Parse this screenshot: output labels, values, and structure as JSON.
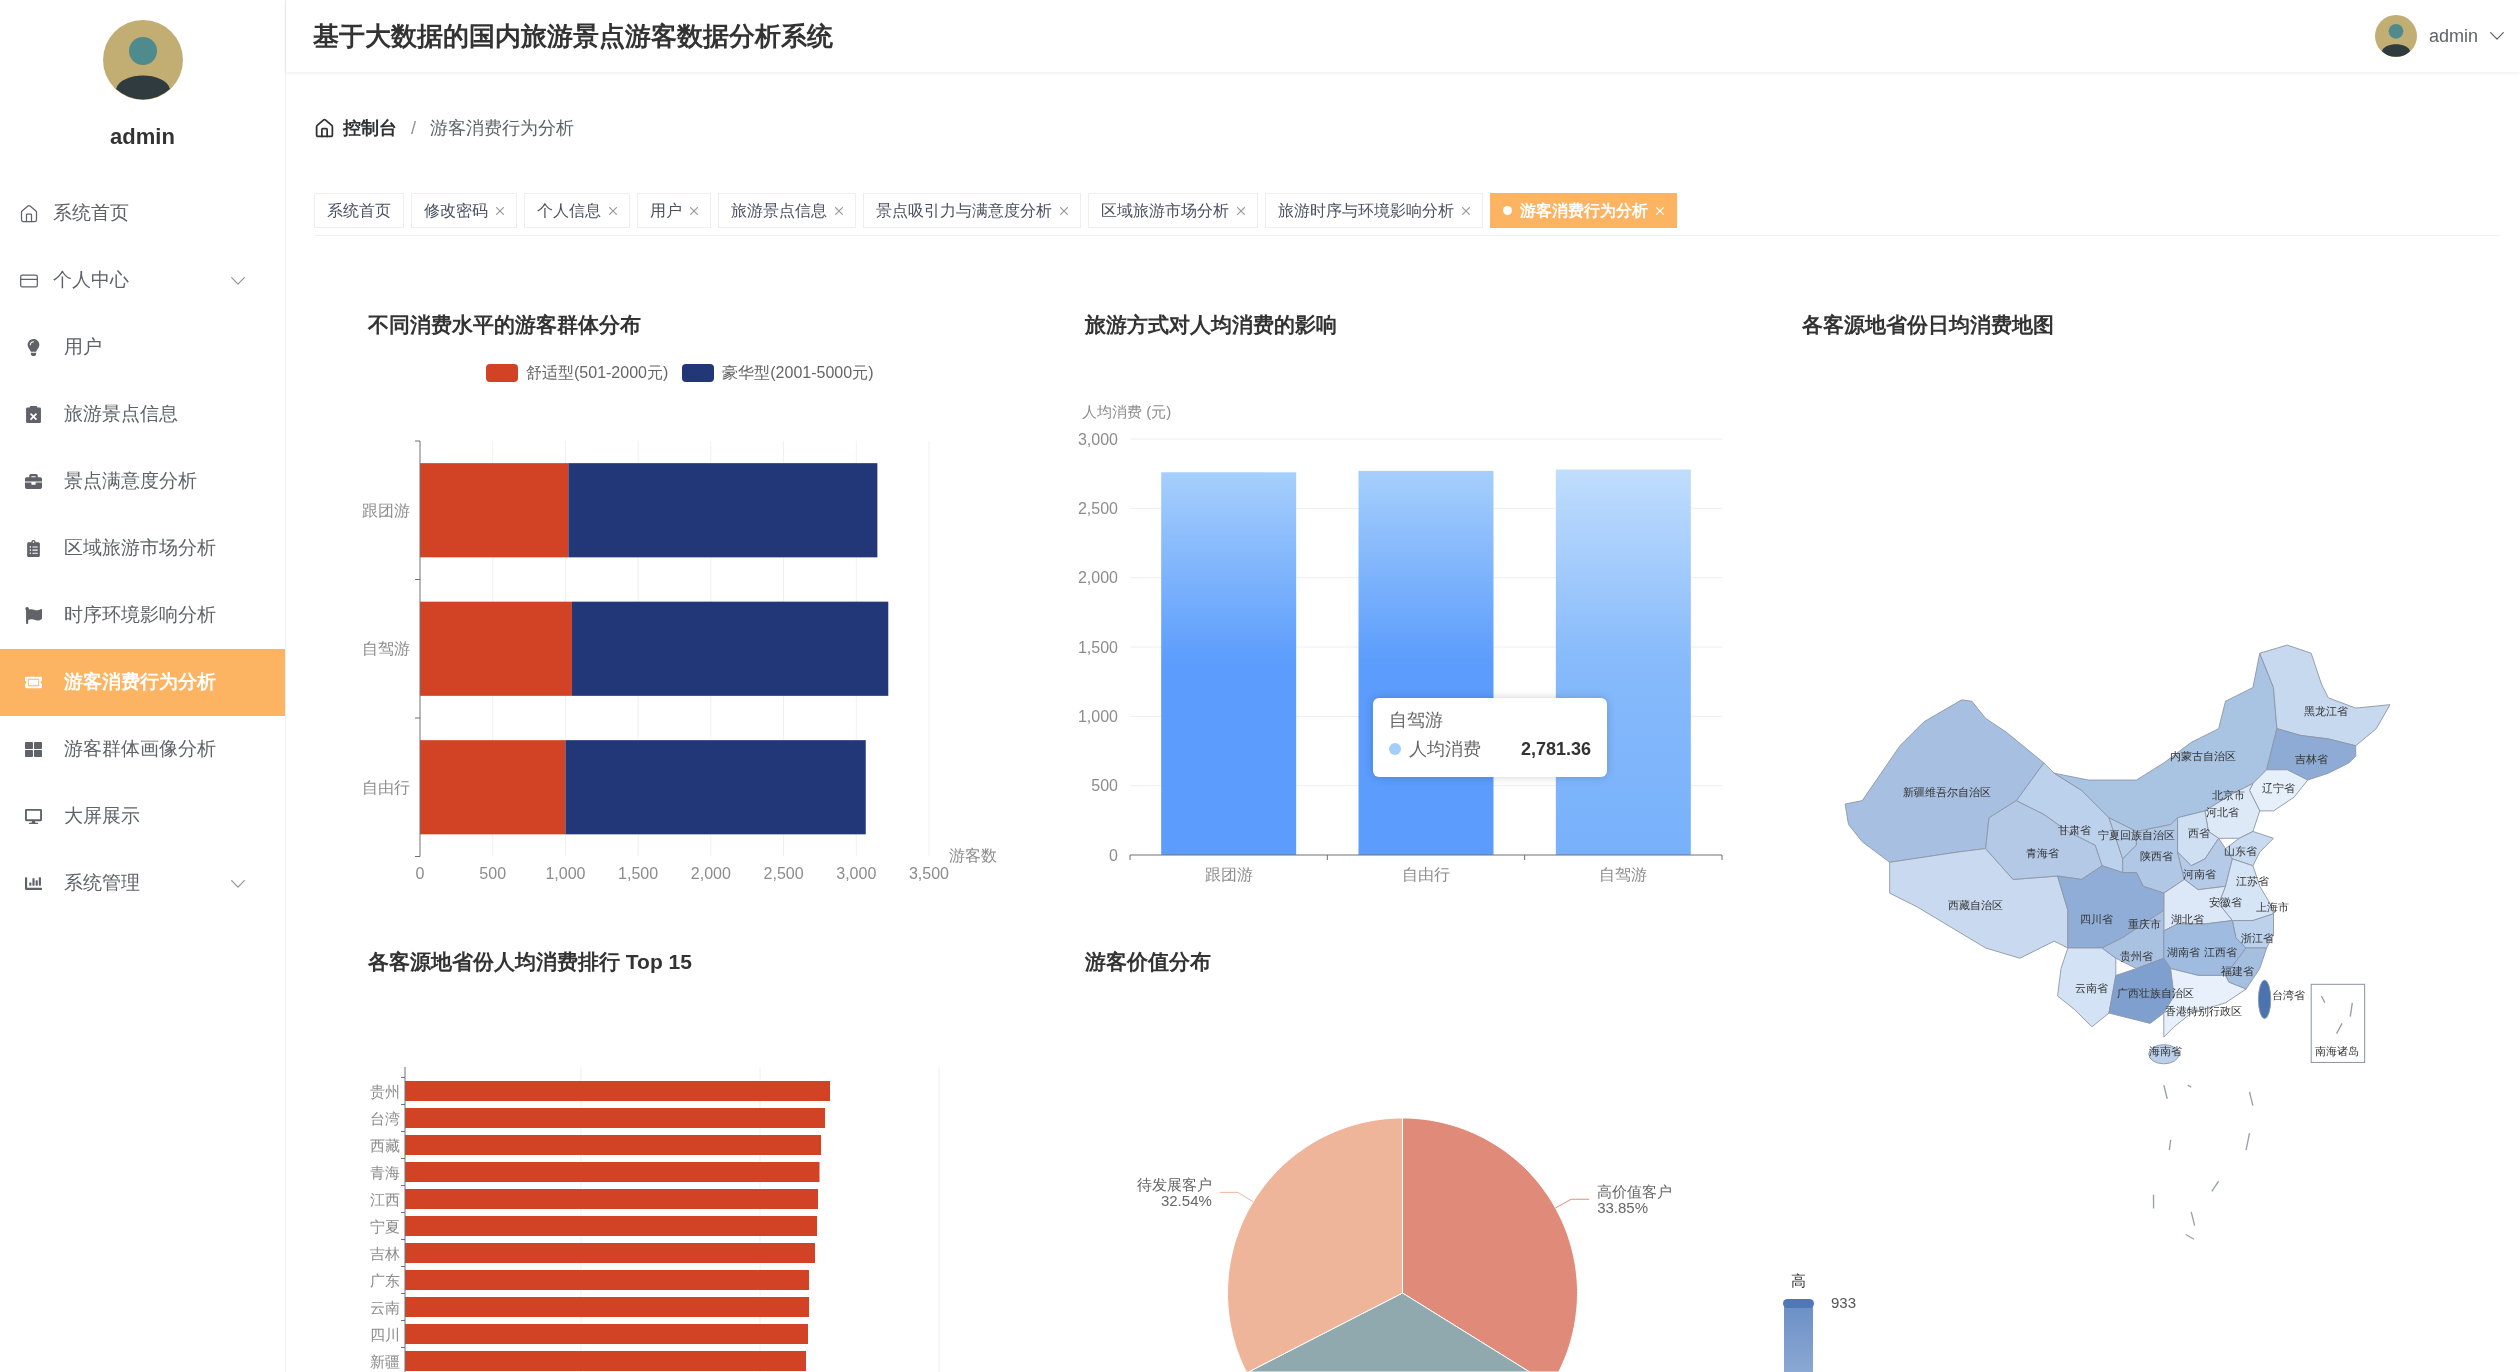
{
  "sidebar": {
    "user": {
      "name": "admin"
    },
    "menu": [
      {
        "label": "系统首页",
        "submenu": false,
        "selected": false
      },
      {
        "label": "个人中心",
        "submenu": true,
        "selected": false
      },
      {
        "label": "用户",
        "submenu": false,
        "selected": false
      },
      {
        "label": "旅游景点信息",
        "submenu": false,
        "selected": false
      },
      {
        "label": "景点满意度分析",
        "submenu": false,
        "selected": false
      },
      {
        "label": "区域旅游市场分析",
        "submenu": false,
        "selected": false
      },
      {
        "label": "时序环境影响分析",
        "submenu": false,
        "selected": false
      },
      {
        "label": "游客消费行为分析",
        "submenu": false,
        "selected": true
      },
      {
        "label": "游客群体画像分析",
        "submenu": false,
        "selected": false
      },
      {
        "label": "大屏展示",
        "submenu": false,
        "selected": false
      },
      {
        "label": "系统管理",
        "submenu": true,
        "selected": false
      }
    ]
  },
  "header": {
    "title": "基于大数据的国内旅游景点游客数据分析系统",
    "user": {
      "name": "admin"
    }
  },
  "breadcrumb": {
    "separator": "/",
    "items": [
      {
        "label": "控制台",
        "kind": "home"
      },
      {
        "label": "游客消费行为分析",
        "kind": "page"
      }
    ]
  },
  "tabs": [
    {
      "label": "系统首页",
      "closable": false,
      "selected": false
    },
    {
      "label": "修改密码",
      "closable": true,
      "selected": false
    },
    {
      "label": "个人信息",
      "closable": true,
      "selected": false
    },
    {
      "label": "用户",
      "closable": true,
      "selected": false
    },
    {
      "label": "旅游景点信息",
      "closable": true,
      "selected": false
    },
    {
      "label": "景点吸引力与满意度分析",
      "closable": true,
      "selected": false
    },
    {
      "label": "区域旅游市场分析",
      "closable": true,
      "selected": false
    },
    {
      "label": "旅游时序与环境影响分析",
      "closable": true,
      "selected": false
    },
    {
      "label": "游客消费行为分析",
      "closable": true,
      "selected": true
    }
  ],
  "dashboard": {
    "consumption_levels": {
      "chart_data": {
        "type": "bar",
        "title": "不同消费水平的游客群体分布",
        "orientation": "horizontal",
        "stacked": true,
        "grid": true,
        "legend": true,
        "xlabel": "游客数",
        "categories": [
          "跟团游",
          "自驾游",
          "自由行"
        ],
        "series": [
          {
            "name": "舒适型(501-2000元)",
            "color": "#d24325",
            "values": [
              1020,
              1045,
              1000
            ]
          },
          {
            "name": "豪华型(2001-5000元)",
            "color": "#223777",
            "values": [
              2125,
              2175,
              2065
            ]
          }
        ],
        "xlim": [
          0,
          3500
        ],
        "xticks": [
          {
            "value": 0,
            "label": "0"
          },
          {
            "value": 500,
            "label": "500"
          },
          {
            "value": 1000,
            "label": "1,000"
          },
          {
            "value": 1500,
            "label": "1,500"
          },
          {
            "value": 2000,
            "label": "2,000"
          },
          {
            "value": 2500,
            "label": "2,500"
          },
          {
            "value": 3000,
            "label": "3,000"
          },
          {
            "value": 3500,
            "label": "3,500"
          }
        ]
      }
    },
    "travel_mode_spending": {
      "chart_data": {
        "type": "bar",
        "title": "旅游方式对人均消费的影响",
        "orientation": "vertical",
        "grid": true,
        "ylabel": "人均消费 (元)",
        "categories": [
          "跟团游",
          "自由行",
          "自驾游"
        ],
        "series": [
          {
            "name": "人均消费",
            "color": "#5b9cfc",
            "values": [
              2760,
              2770,
              2780
            ]
          }
        ],
        "ylim": [
          0,
          3000
        ],
        "yticks": [
          {
            "value": 0,
            "label": "0"
          },
          {
            "value": 500,
            "label": "500"
          },
          {
            "value": 1000,
            "label": "1,000"
          },
          {
            "value": 1500,
            "label": "1,500"
          },
          {
            "value": 2000,
            "label": "2,000"
          },
          {
            "value": 2500,
            "label": "2,500"
          },
          {
            "value": 3000,
            "label": "3,000"
          }
        ]
      },
      "highlighted": [
        false,
        false,
        true
      ],
      "tooltip": {
        "title": "自驾游",
        "value": "2,781.36"
      }
    },
    "province_map": {
      "title": "各客源地省份日均消费地图",
      "labels": [
        "黑龙江省",
        "内蒙古自治区",
        "吉林省",
        "新疆维吾尔自治区",
        "北京市",
        "辽宁省",
        "河北省",
        "甘肃省",
        "宁夏回族自治区",
        "西省",
        "青海省",
        "陕西省",
        "山东省",
        "河南省",
        "江苏省",
        "西藏自治区",
        "安徽省",
        "上海市",
        "四川省",
        "重庆市",
        "湖北省",
        "浙江省",
        "贵州省",
        "湖南省",
        "江西省",
        "福建省",
        "云南省",
        "广西壮族自治区",
        "台湾省",
        "香港特别行政区",
        "海南省"
      ],
      "inset_label": "南海诸岛",
      "visual_map": {
        "high_label": "高",
        "value": "933"
      }
    },
    "province_ranking": {
      "title": "各客源地省份人均消费排行 Top 15",
      "labels": [
        "贵州",
        "台湾",
        "西藏",
        "青海",
        "江西",
        "宁夏",
        "吉林",
        "广东",
        "云南",
        "四川",
        "新疆"
      ]
    },
    "customer_value": {
      "chart_data": {
        "type": "pie",
        "title": "游客价值分布",
        "categories": [
          "高价值客户",
          null,
          "待发展客户"
        ],
        "values": [
          33.85,
          33.61,
          32.54
        ],
        "value_labels": [
          "33.85%",
          null,
          "32.54%"
        ],
        "colors": [
          "#e08b7a",
          "#90a9ae",
          "#efb59b"
        ]
      }
    }
  }
}
